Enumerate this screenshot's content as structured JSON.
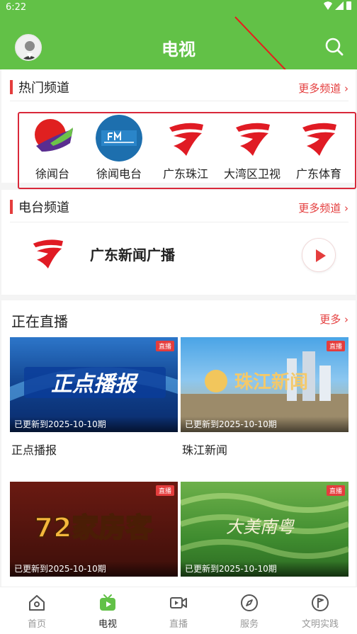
{
  "status_bar": {
    "time": "6:22"
  },
  "header": {
    "title": "电视"
  },
  "hot": {
    "title": "热门频道",
    "more": "更多频道 ›",
    "channels": [
      {
        "name": "徐闻台"
      },
      {
        "name": "徐闻电台"
      },
      {
        "name": "广东珠江"
      },
      {
        "name": "大湾区卫视"
      },
      {
        "name": "广东体育"
      }
    ]
  },
  "radio": {
    "title": "电台频道",
    "more": "更多频道 ›",
    "item": {
      "name": "广东新闻广播"
    }
  },
  "live": {
    "title": "正在直播",
    "more": "更多 ›",
    "badge": "直播",
    "items": [
      {
        "title": "正点播报",
        "update": "已更新到2025-10-10期",
        "thumb_text": "正点播报"
      },
      {
        "title": "珠江新闻",
        "update": "已更新到2025-10-10期",
        "thumb_text": "珠江新闻"
      },
      {
        "title": "",
        "update": "已更新到2025-10-10期",
        "thumb_text": "72家房客"
      },
      {
        "title": "",
        "update": "已更新到2025-10-10期",
        "thumb_text": "大美南粤"
      }
    ]
  },
  "tabbar": {
    "items": [
      {
        "label": "首页"
      },
      {
        "label": "电视"
      },
      {
        "label": "直播"
      },
      {
        "label": "服务"
      },
      {
        "label": "文明实践"
      }
    ]
  },
  "colors": {
    "brand_green": "#62c147",
    "accent_red": "#e43d3d"
  }
}
